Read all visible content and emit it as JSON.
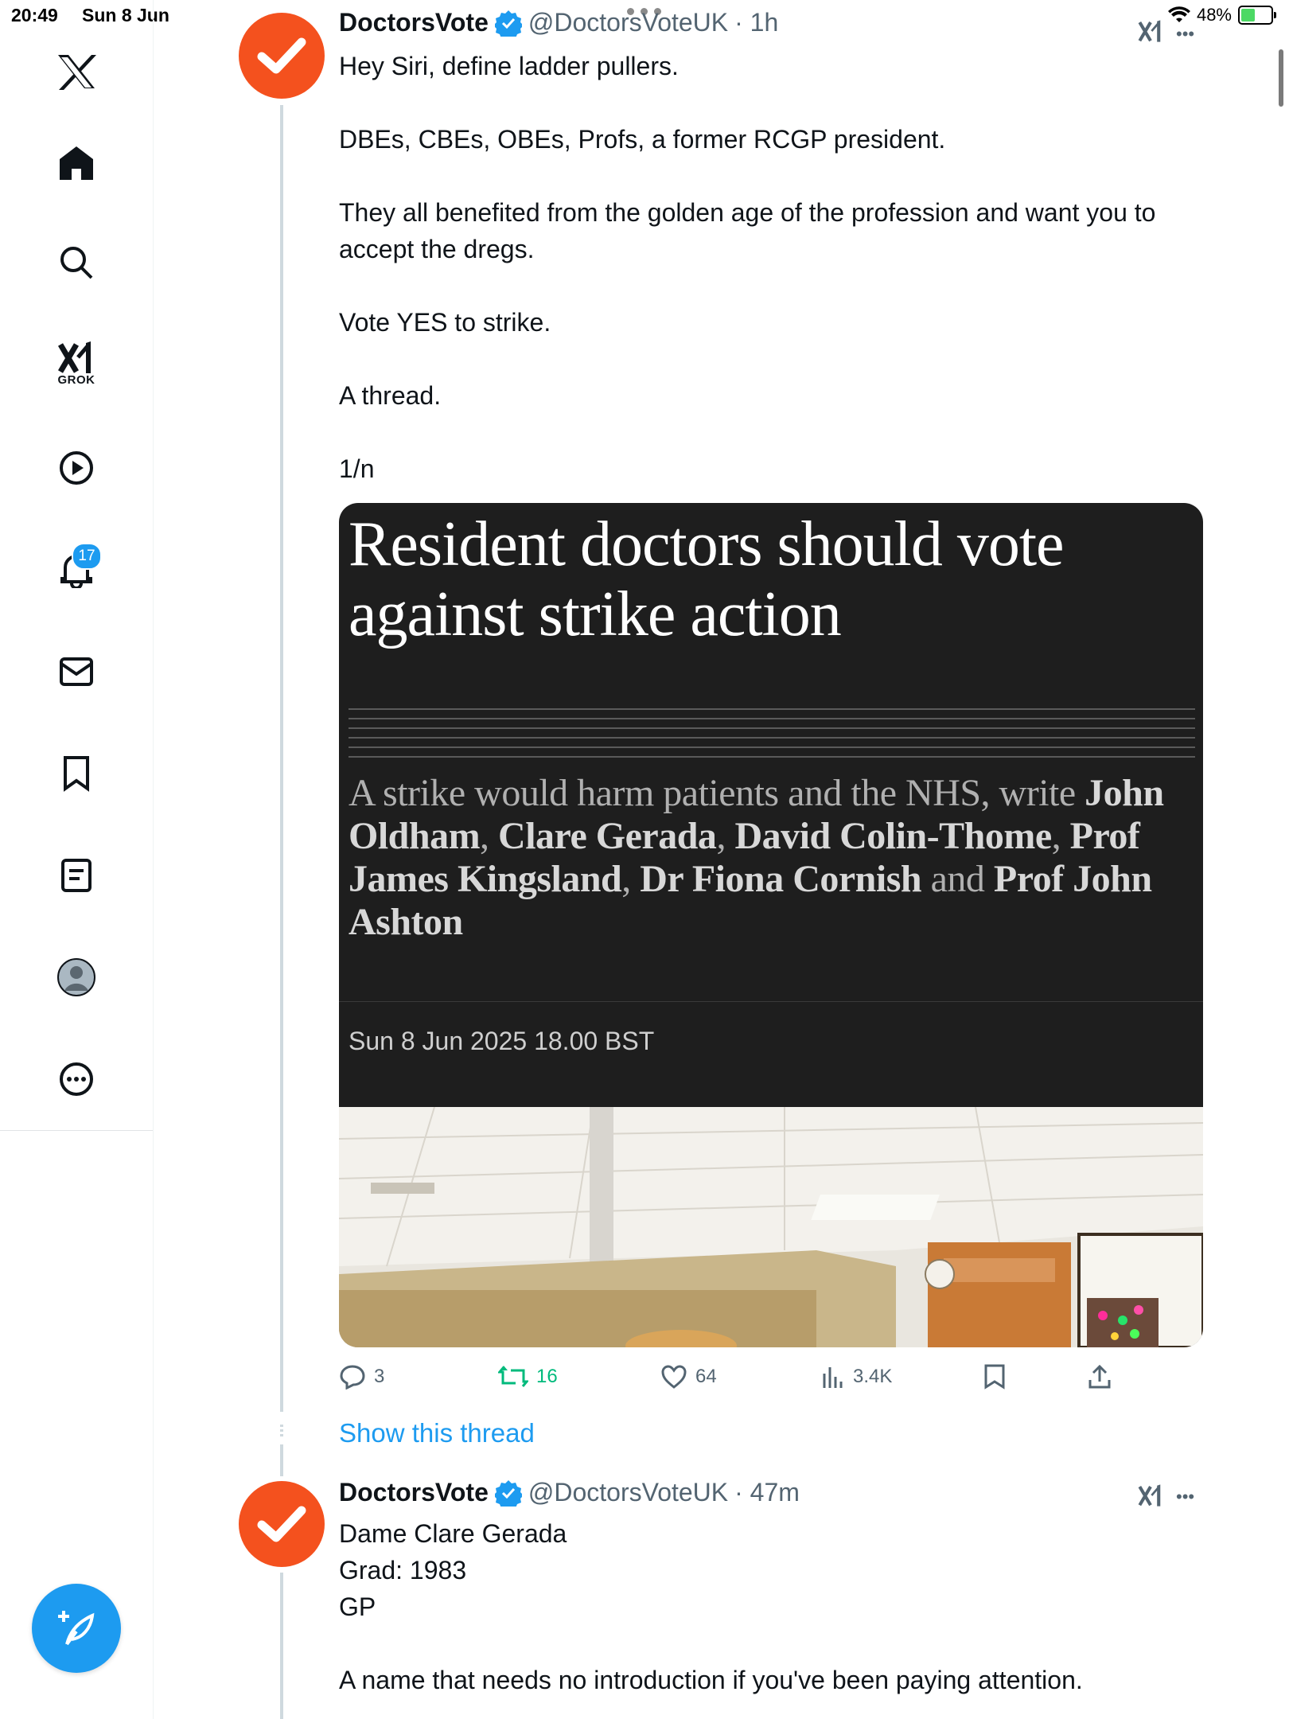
{
  "status_bar": {
    "time": "20:49",
    "date": "Sun 8 Jun",
    "battery": "48%",
    "battery_level": 0.48
  },
  "sidebar": {
    "items": [
      {
        "name": "home"
      },
      {
        "name": "explore"
      },
      {
        "name": "grok",
        "label": "GROK"
      },
      {
        "name": "videos"
      },
      {
        "name": "notifications",
        "badge": "17"
      },
      {
        "name": "messages"
      },
      {
        "name": "bookmarks"
      },
      {
        "name": "lists"
      },
      {
        "name": "profile"
      },
      {
        "name": "more"
      }
    ]
  },
  "tweet1": {
    "name": "DoctorsVote",
    "handle": "@DoctorsVoteUK",
    "time": "· 1h",
    "text": "Hey Siri, define ladder pullers.\n\nDBEs, CBEs, OBEs, Profs, a former RCGP president.\n\nThey all benefited from the golden age of the profession and want you to accept the dregs.\n\nVote YES to strike.\n\nA thread.\n\n1/n",
    "card": {
      "headline": "Resident doctors should vote against strike action",
      "standfirst_lead": "A strike would harm patients and the NHS, write ",
      "authors": [
        "John Oldham",
        "Clare Gerada",
        "David Colin-Thome",
        "Prof James Kingsland",
        "Dr Fiona Cornish",
        "Prof John Ashton"
      ],
      "sep_comma": ", ",
      "sep_and": " and ",
      "date": "Sun 8 Jun 2025 18.00 BST"
    },
    "actions": {
      "replies": "3",
      "reposts": "16",
      "likes": "64",
      "views": "3.4K"
    }
  },
  "show_thread": "Show this thread",
  "tweet2": {
    "name": "DoctorsVote",
    "handle": "@DoctorsVoteUK",
    "time": "· 47m",
    "text": "Dame Clare Gerada\nGrad: 1983\nGP\n\nA name that needs no introduction if you've been paying attention."
  },
  "colors": {
    "accent": "#1d9bf0",
    "avatar": "#f4511e",
    "repost_green": "#00ba7c",
    "card_bg": "#1e1e1e"
  }
}
